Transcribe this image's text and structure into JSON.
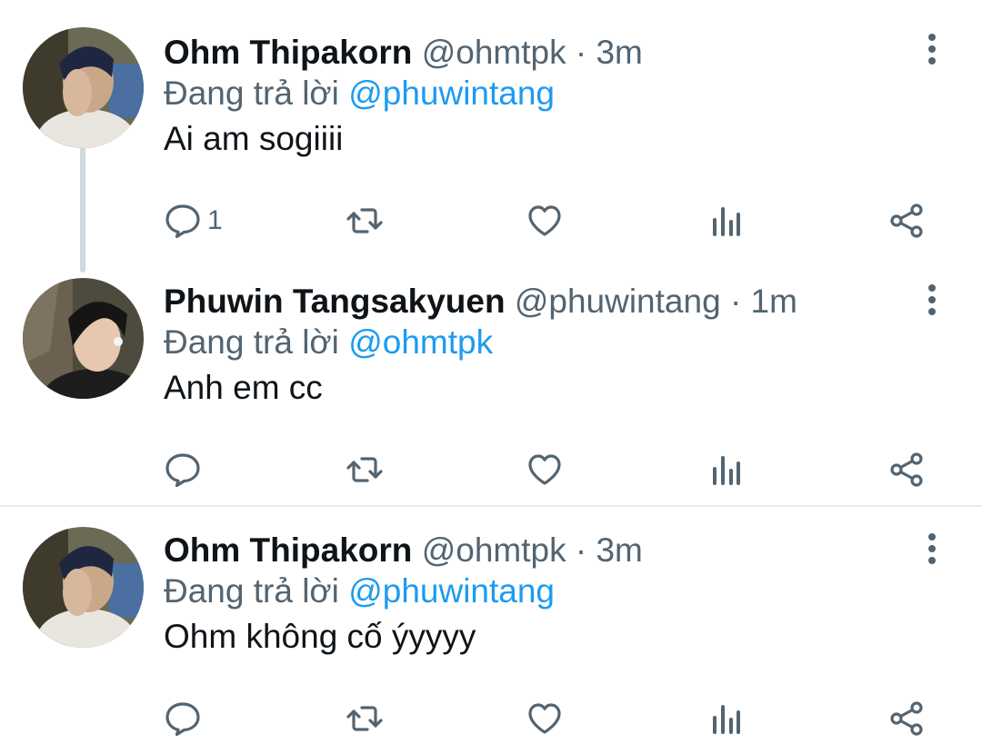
{
  "tweets": [
    {
      "name": "Ohm Thipakorn",
      "handle": "@ohmtpk",
      "separator": "·",
      "time": "3m",
      "reply_prefix": "Đang trả lời",
      "reply_to": "@phuwintang",
      "text": "Ai am sogiiii",
      "reply_count": "1"
    },
    {
      "name": "Phuwin Tangsakyuen",
      "handle": "@phuwintang",
      "separator": "·",
      "time": "1m",
      "reply_prefix": "Đang trả lời",
      "reply_to": "@ohmtpk",
      "text": "Anh em cc",
      "reply_count": ""
    },
    {
      "name": "Ohm Thipakorn",
      "handle": "@ohmtpk",
      "separator": "·",
      "time": "3m",
      "reply_prefix": "Đang trả lời",
      "reply_to": "@phuwintang",
      "text": "Ohm không cố ýyyyy",
      "reply_count": ""
    }
  ],
  "icons": {
    "reply": "reply-icon",
    "retweet": "retweet-icon",
    "like": "heart-icon",
    "analytics": "analytics-icon",
    "share": "share-icon",
    "more": "more-vertical-icon"
  },
  "colors": {
    "name": "#0f1419",
    "secondary": "#536471",
    "mention": "#1d9bf0",
    "thread_line": "#cfd9de",
    "divider": "#e6ecf0"
  }
}
